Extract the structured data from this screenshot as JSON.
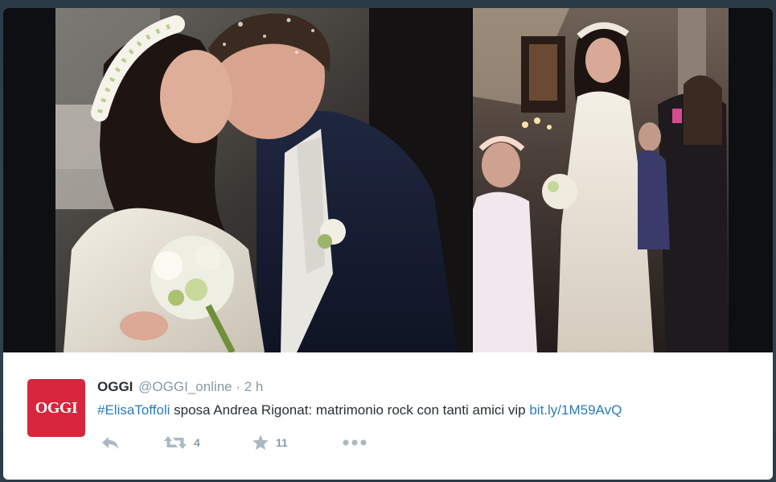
{
  "tweet": {
    "name": "OGGI",
    "handle": "@OGGI_online",
    "separator": " · ",
    "time": "2 h",
    "hashtag": "#ElisaToffoli",
    "text": " sposa Andrea Rigonat: matrimonio rock con tanti amici vip ",
    "link": "bit.ly/1M59AvQ",
    "avatar_text": "OGGI",
    "avatar_color": "#d7263d",
    "link_color": "#2b7bb9"
  },
  "actions": {
    "reply_icon": "reply-icon",
    "retweet_icon": "retweet-icon",
    "retweet_count": "4",
    "favorite_icon": "star-icon",
    "favorite_count": "11",
    "more_icon": "more-icon"
  },
  "media": {
    "left_photo": "wedding-kiss-photo",
    "right_photo": "bride-walking-photo"
  }
}
